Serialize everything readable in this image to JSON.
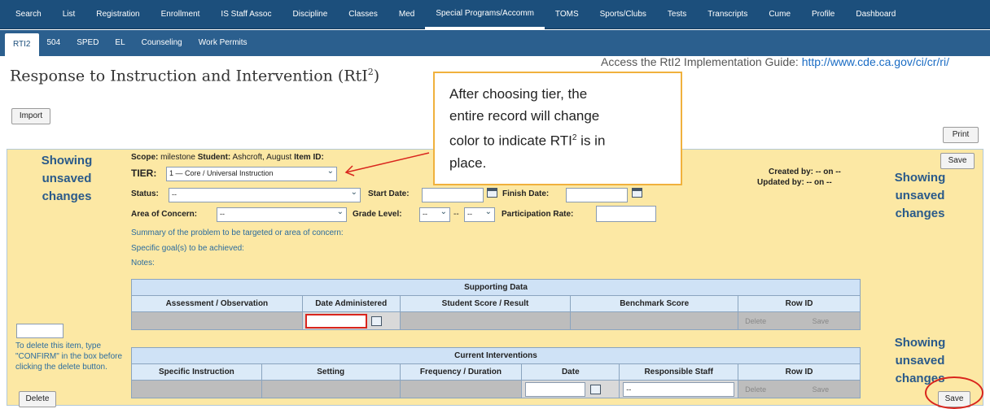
{
  "top_nav": [
    "Search",
    "List",
    "Registration",
    "Enrollment",
    "IS Staff Assoc",
    "Discipline",
    "Classes",
    "Med",
    "Special Programs/Accomm",
    "TOMS",
    "Sports/Clubs",
    "Tests",
    "Transcripts",
    "Cume",
    "Profile",
    "Dashboard"
  ],
  "top_nav_active": "Special Programs/Accomm",
  "sub_nav": [
    "RTI2",
    "504",
    "SPED",
    "EL",
    "Counseling",
    "Work Permits"
  ],
  "sub_nav_active": "RTI2",
  "page": {
    "title": "Response to Instruction and Intervention (RtI",
    "title_sup": "2",
    "title_end": ")",
    "guide_text": "Access the RtI2 Implementation Guide: ",
    "guide_link": "http://www.cde.ca.gov/ci/cr/ri/"
  },
  "buttons": {
    "import": "Import",
    "print": "Print",
    "save": "Save",
    "delete": "Delete",
    "row_delete": "Delete",
    "row_save": "Save"
  },
  "callout": {
    "line1": "After choosing tier, the",
    "line2": "entire record will change",
    "line3": "color to indicate RTI",
    "line3_sup": "2",
    "line3_end": " is in",
    "line4": "place."
  },
  "showing_unsaved": [
    "Showing",
    "unsaved",
    "changes"
  ],
  "record": {
    "scope_label": "Scope:",
    "scope_value": "milestone",
    "student_label": "Student:",
    "student_value": "Ashcroft, August",
    "item_id_label": "Item ID:",
    "tier_label": "TIER:",
    "tier_value": "1 — Core / Universal Instruction",
    "status_label": "Status:",
    "status_value": "--",
    "start_date_label": "Start Date:",
    "finish_date_label": "Finish Date:",
    "area_label": "Area of Concern:",
    "area_value": "--",
    "grade_label": "Grade Level:",
    "grade_from": "--",
    "grade_sep": "--",
    "grade_to": "--",
    "participation_label": "Participation Rate:",
    "created_by": "Created by: -- on --",
    "updated_by": "Updated by: --  on --",
    "summary_label": "Summary of the problem to be targeted or area of concern:",
    "goals_label": "Specific goal(s) to be achieved:",
    "notes_label": "Notes:"
  },
  "supporting_data": {
    "caption": "Supporting Data",
    "columns": [
      "Assessment / Observation",
      "Date Administered",
      "Student Score / Result",
      "Benchmark Score",
      "Row ID"
    ]
  },
  "current_interventions": {
    "caption": "Current Interventions",
    "columns": [
      "Specific Instruction",
      "Setting",
      "Frequency / Duration",
      "Date",
      "Responsible Staff",
      "Row ID"
    ],
    "staff_value": "--"
  },
  "delete_note": "To delete this item, type \"CONFIRM\" in the box before clicking the delete button.",
  "colors": {
    "nav_bg": "#1c4f7c",
    "record_bg": "#fce8a4",
    "callout_border": "#f0b13d",
    "annotation_red": "#d9251d"
  }
}
